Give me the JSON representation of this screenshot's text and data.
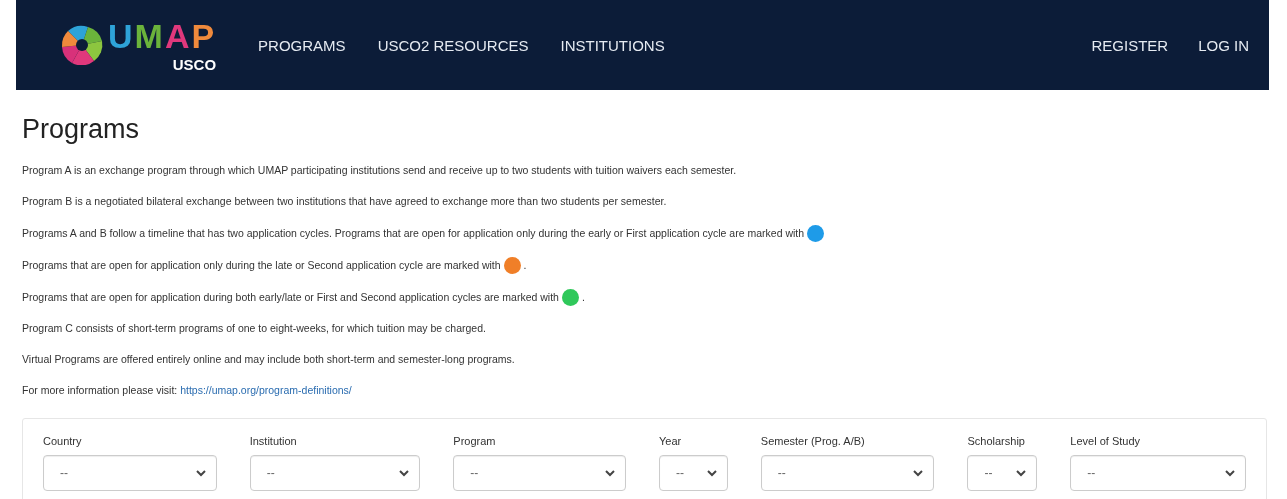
{
  "header": {
    "logo": {
      "name": "UMAP",
      "subtitle": "USCO"
    },
    "nav": [
      {
        "label": "PROGRAMS"
      },
      {
        "label": "USCO2 RESOURCES"
      },
      {
        "label": "INSTITUTIONS"
      }
    ],
    "account": [
      {
        "label": "REGISTER"
      },
      {
        "label": "LOG IN"
      }
    ]
  },
  "page": {
    "title": "Programs",
    "paragraphs": [
      {
        "kind": "text",
        "text": "Program A is an exchange program through which UMAP participating institutions send and receive up to two students with tuition waivers each semester."
      },
      {
        "kind": "text",
        "text": "Program B is a negotiated bilateral exchange between two institutions that have agreed to exchange more than two students per semester."
      },
      {
        "kind": "badge",
        "text": "Programs A and B follow a timeline that has two application cycles. Programs that are open for application only during the early or First application cycle are marked with",
        "color": "#1e9be8"
      },
      {
        "kind": "badge",
        "text": "Programs that are open for application only during the late or Second application cycle are marked with",
        "color": "#f07f28",
        "after": "."
      },
      {
        "kind": "badge",
        "text": "Programs that are open for application during both early/late or First and Second application cycles are marked with",
        "color": "#2fc85a",
        "after": "."
      },
      {
        "kind": "text",
        "text": "Program C consists of short-term programs of one to eight-weeks, for which tuition may be charged."
      },
      {
        "kind": "text",
        "text": "Virtual Programs are offered entirely online and may include both short-term and semester-long programs."
      },
      {
        "kind": "link",
        "text": "For more information please visit:",
        "link": "https://umap.org/program-definitions/"
      }
    ]
  },
  "filters": [
    {
      "label": "Country",
      "value": "--"
    },
    {
      "label": "Institution",
      "value": "--"
    },
    {
      "label": "Program",
      "value": "--"
    },
    {
      "label": "Year",
      "value": "--"
    },
    {
      "label": "Semester (Prog. A/B)",
      "value": "--"
    },
    {
      "label": "Scholarship",
      "value": "--"
    },
    {
      "label": "Level of Study",
      "value": "--"
    }
  ]
}
